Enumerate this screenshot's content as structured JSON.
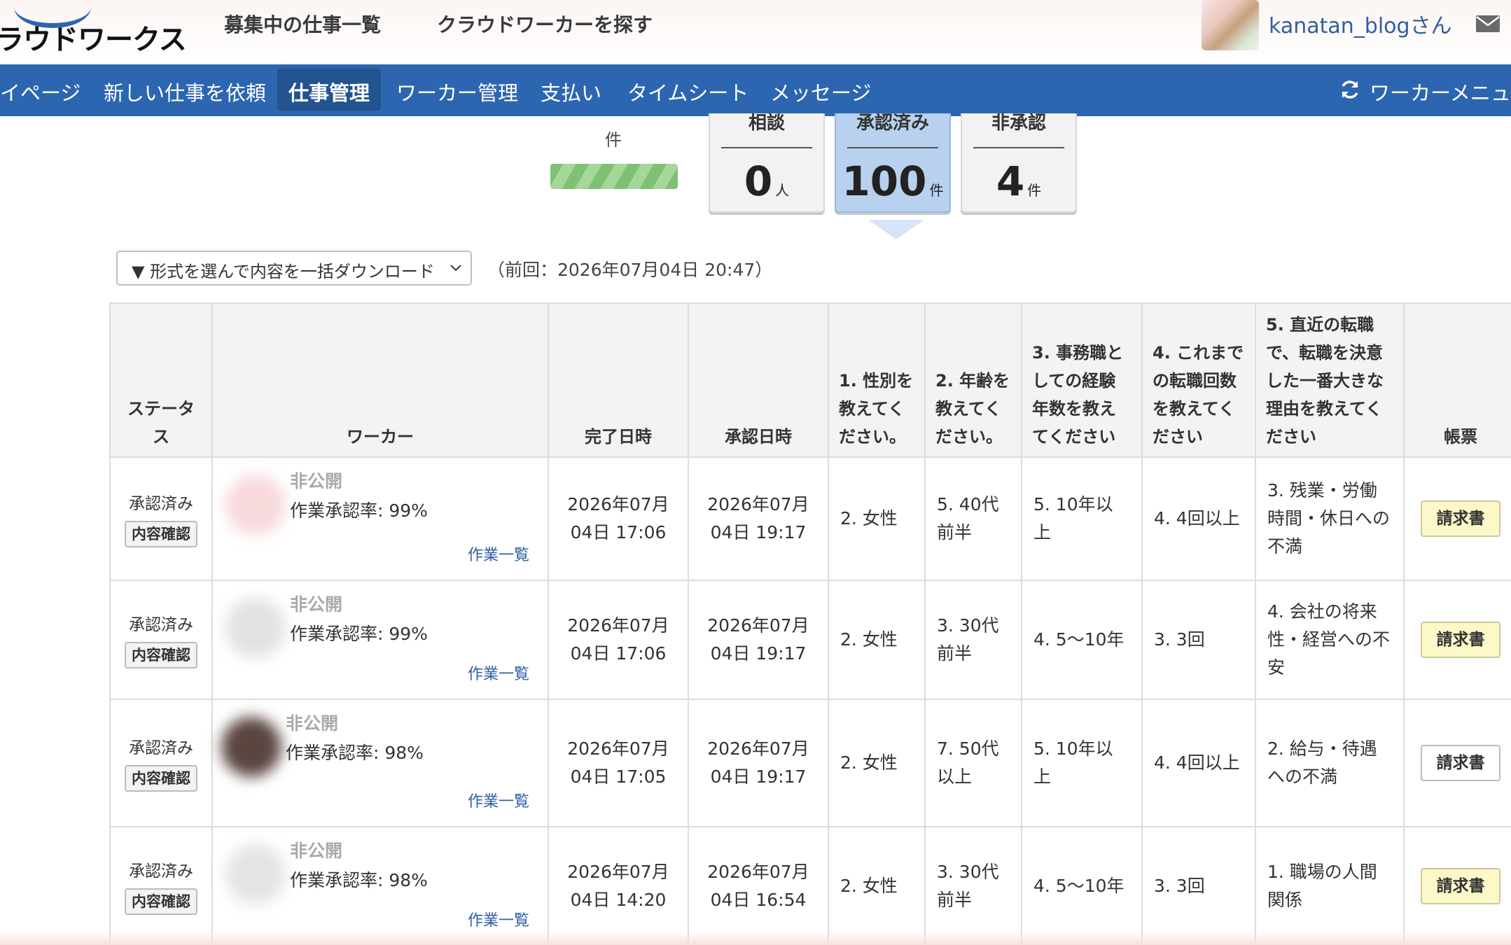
{
  "header": {
    "logo_text": "ラウドワークス",
    "links": [
      "募集中の仕事一覧",
      "クラウドワーカーを探す"
    ],
    "username": "kanatan_blogさん",
    "icons": {
      "avatar": "user-avatar",
      "mail": "mail-icon"
    }
  },
  "nav": {
    "items": [
      "イページ",
      "新しい仕事を依頼",
      "仕事管理",
      "ワーカー管理",
      "支払い",
      "タイムシート",
      "メッセージ"
    ],
    "active": "仕事管理",
    "right_label": "ワーカーメニュー",
    "right_icon": "refresh-icon",
    "color": "#2d66b0"
  },
  "summary": {
    "top_unit": "件",
    "boxes": [
      {
        "label": "相談",
        "value": "0",
        "unit": "人",
        "selected": false
      },
      {
        "label": "承認済み",
        "value": "100",
        "unit": "件",
        "selected": true
      },
      {
        "label": "非承認",
        "value": "4",
        "unit": "件",
        "selected": false
      }
    ]
  },
  "download": {
    "select_label": "▼ 形式を選んで内容を一括ダウンロード",
    "last_download": "（前回：2026年07月04日 20:47）"
  },
  "table": {
    "headers": {
      "status": "ステータス",
      "worker": "ワーカー",
      "completed": "完了日時",
      "approved": "承認日時",
      "q1": "1. 性別を教えてください。",
      "q2": "2. 年齢を教えてください。",
      "q3": "3. 事務職としての経験年数を教えてください",
      "q4": "4. これまでの転職回数を教えてください",
      "q5": "5. 直近の転職で、転職を決意した一番大きな理由を教えてください",
      "invoice": "帳票"
    },
    "rows": [
      {
        "status": "承認済み",
        "confirm": "内容確認",
        "worker_name": "非公開",
        "rate": "作業承認率: 99%",
        "work_list": "作業一覧",
        "completed": "2026年07月04日 17:06",
        "approved": "2026年07月04日 19:17",
        "q1": "2. 女性",
        "q2": "5. 40代前半",
        "q3": "5. 10年以上",
        "q4": "4. 4回以上",
        "q5": "3. 残業・労働時間・休日への不満",
        "invoice": "請求書",
        "invoice_highlight": true
      },
      {
        "status": "承認済み",
        "confirm": "内容確認",
        "worker_name": "非公開",
        "rate": "作業承認率: 99%",
        "work_list": "作業一覧",
        "completed": "2026年07月04日 17:06",
        "approved": "2026年07月04日 19:17",
        "q1": "2. 女性",
        "q2": "3. 30代前半",
        "q3": "4. 5〜10年",
        "q4": "3. 3回",
        "q5": "4. 会社の将来性・経営への不安",
        "invoice": "請求書",
        "invoice_highlight": true
      },
      {
        "status": "承認済み",
        "confirm": "内容確認",
        "worker_name": "非公開",
        "rate": "作業承認率: 98%",
        "work_list": "作業一覧",
        "completed": "2026年07月04日 17:05",
        "approved": "2026年07月04日 19:17",
        "q1": "2. 女性",
        "q2": "7. 50代以上",
        "q3": "5. 10年以上",
        "q4": "4. 4回以上",
        "q5": "2. 給与・待遇への不満",
        "invoice": "請求書",
        "invoice_highlight": false
      },
      {
        "status": "承認済み",
        "confirm": "内容確認",
        "worker_name": "非公開",
        "rate": "作業承認率: 98%",
        "work_list": "作業一覧",
        "completed": "2026年07月04日 14:20",
        "approved": "2026年07月04日 16:54",
        "q1": "2. 女性",
        "q2": "3. 30代前半",
        "q3": "4. 5〜10年",
        "q4": "3. 3回",
        "q5": "1. 職場の人間関係",
        "invoice": "請求書",
        "invoice_highlight": true
      }
    ]
  }
}
